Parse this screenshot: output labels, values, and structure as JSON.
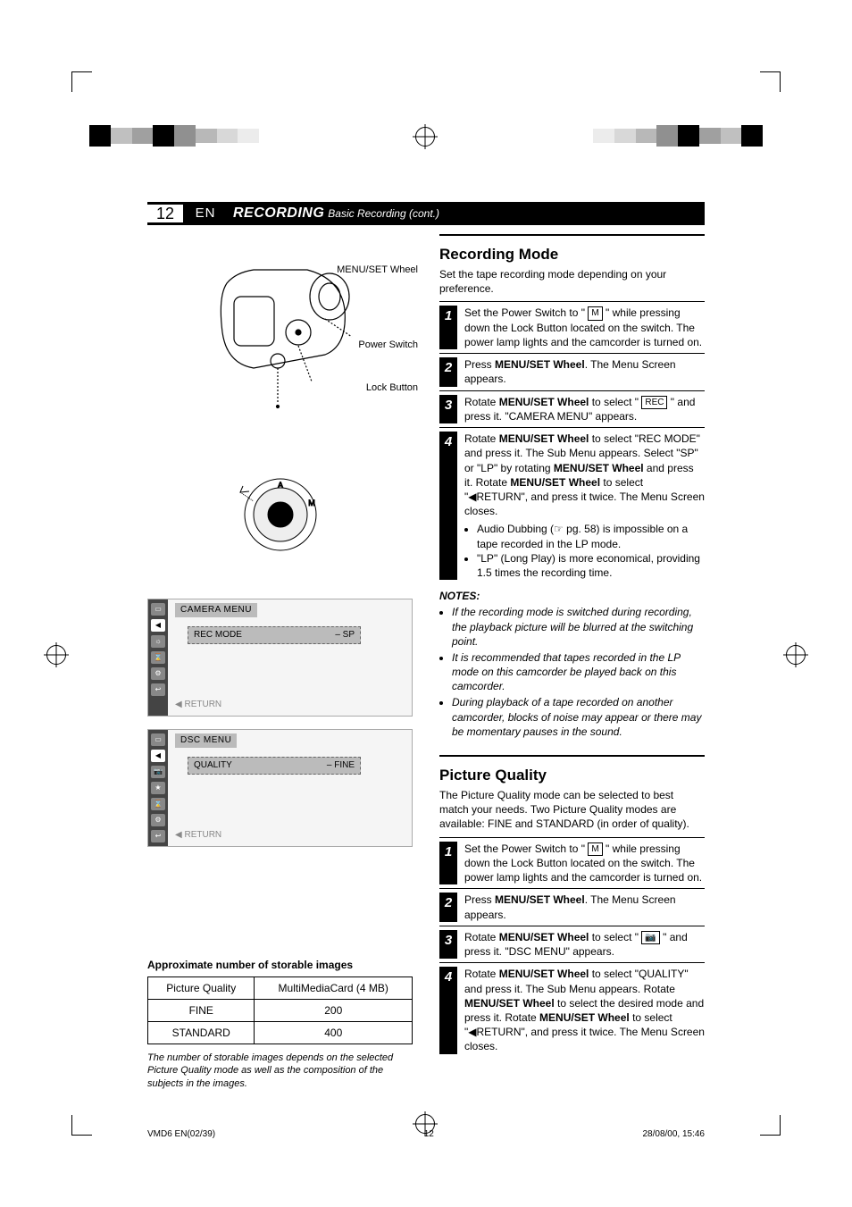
{
  "page": {
    "number": "12",
    "lang": "EN",
    "chapter_title": "RECORDING",
    "chapter_subtitle": "Basic Recording (cont.)"
  },
  "left": {
    "camcorder_labels": {
      "menu_set_wheel": "MENU/SET Wheel",
      "power_switch": "Power Switch",
      "lock_button": "Lock Button"
    },
    "dial_outer": [
      "A",
      "M"
    ],
    "camera_menu": {
      "title": "CAMERA MENU",
      "row_label": "REC MODE",
      "row_value": "– SP",
      "return_label": "RETURN"
    },
    "dsc_menu": {
      "title": "DSC MENU",
      "row_label": "QUALITY",
      "row_value": "– FINE",
      "return_label": "RETURN"
    },
    "storable": {
      "heading": "Approximate number of storable images",
      "columns": [
        "Picture Quality",
        "MultiMediaCard (4 MB)"
      ],
      "rows": [
        {
          "quality": "FINE",
          "count": "200"
        },
        {
          "quality": "STANDARD",
          "count": "400"
        }
      ],
      "footnote": "The number of storable images depends on the selected Picture Quality mode as well as the composition of the subjects in the images."
    }
  },
  "right": {
    "recmode": {
      "title": "Recording Mode",
      "intro": "Set the tape recording mode depending on your preference.",
      "steps": [
        {
          "n": "1",
          "html": "Set the Power Switch to \" [M] \" while pressing down the Lock Button located on the switch. The power lamp lights and the camcorder is turned on."
        },
        {
          "n": "2",
          "pre": "Press ",
          "ctrl": "MENU/SET Wheel",
          "post": ". The Menu Screen appears."
        },
        {
          "n": "3",
          "pre": "Rotate ",
          "ctrl": "MENU/SET Wheel",
          "mid": " to select \" ",
          "icon": "REC",
          "post": " \" and press it. \"CAMERA MENU\" appears."
        },
        {
          "n": "4",
          "body": "Rotate MENU/SET Wheel to select \"REC MODE\" and press it. The Sub Menu appears. Select \"SP\" or \"LP\" by rotating MENU/SET Wheel and press it. Rotate MENU/SET Wheel to select \"◀RETURN\", and press it twice. The Menu Screen closes.",
          "bullets": [
            "Audio Dubbing (☞ pg. 58) is impossible on a tape recorded in the LP mode.",
            "\"LP\" (Long Play) is more economical, providing 1.5 times the recording time."
          ]
        }
      ],
      "notes_head": "NOTES:",
      "notes": [
        "If the recording mode is switched during recording, the playback picture will be blurred at the switching point.",
        "It is recommended that tapes recorded in the LP mode on this camcorder be played back on this camcorder.",
        "During playback of a tape recorded on another camcorder, blocks of noise may appear or there may be momentary pauses in the sound."
      ]
    },
    "picq": {
      "title": "Picture Quality",
      "intro": "The Picture Quality mode can be selected to best match your needs. Two Picture Quality modes are available: FINE and STANDARD (in order of quality).",
      "steps": [
        {
          "n": "1",
          "html": "Set the Power Switch to \" [M] \" while pressing down the Lock Button located on the switch. The power lamp lights and the camcorder is turned on."
        },
        {
          "n": "2",
          "pre": "Press ",
          "ctrl": "MENU/SET Wheel",
          "post": ". The Menu Screen appears."
        },
        {
          "n": "3",
          "pre": "Rotate ",
          "ctrl": "MENU/SET Wheel",
          "mid": " to select \" ",
          "icon": "📷",
          "post": " \" and press it. \"DSC MENU\" appears."
        },
        {
          "n": "4",
          "body": "Rotate MENU/SET Wheel to select \"QUALITY\" and press it. The Sub Menu appears. Rotate MENU/SET Wheel to select the desired mode and press it. Rotate MENU/SET Wheel to select \"◀RETURN\", and press it twice. The Menu Screen closes."
        }
      ]
    }
  },
  "footer": {
    "left": "VMD6 EN(02/39)",
    "center": "12",
    "right": "28/08/00, 15:46"
  }
}
